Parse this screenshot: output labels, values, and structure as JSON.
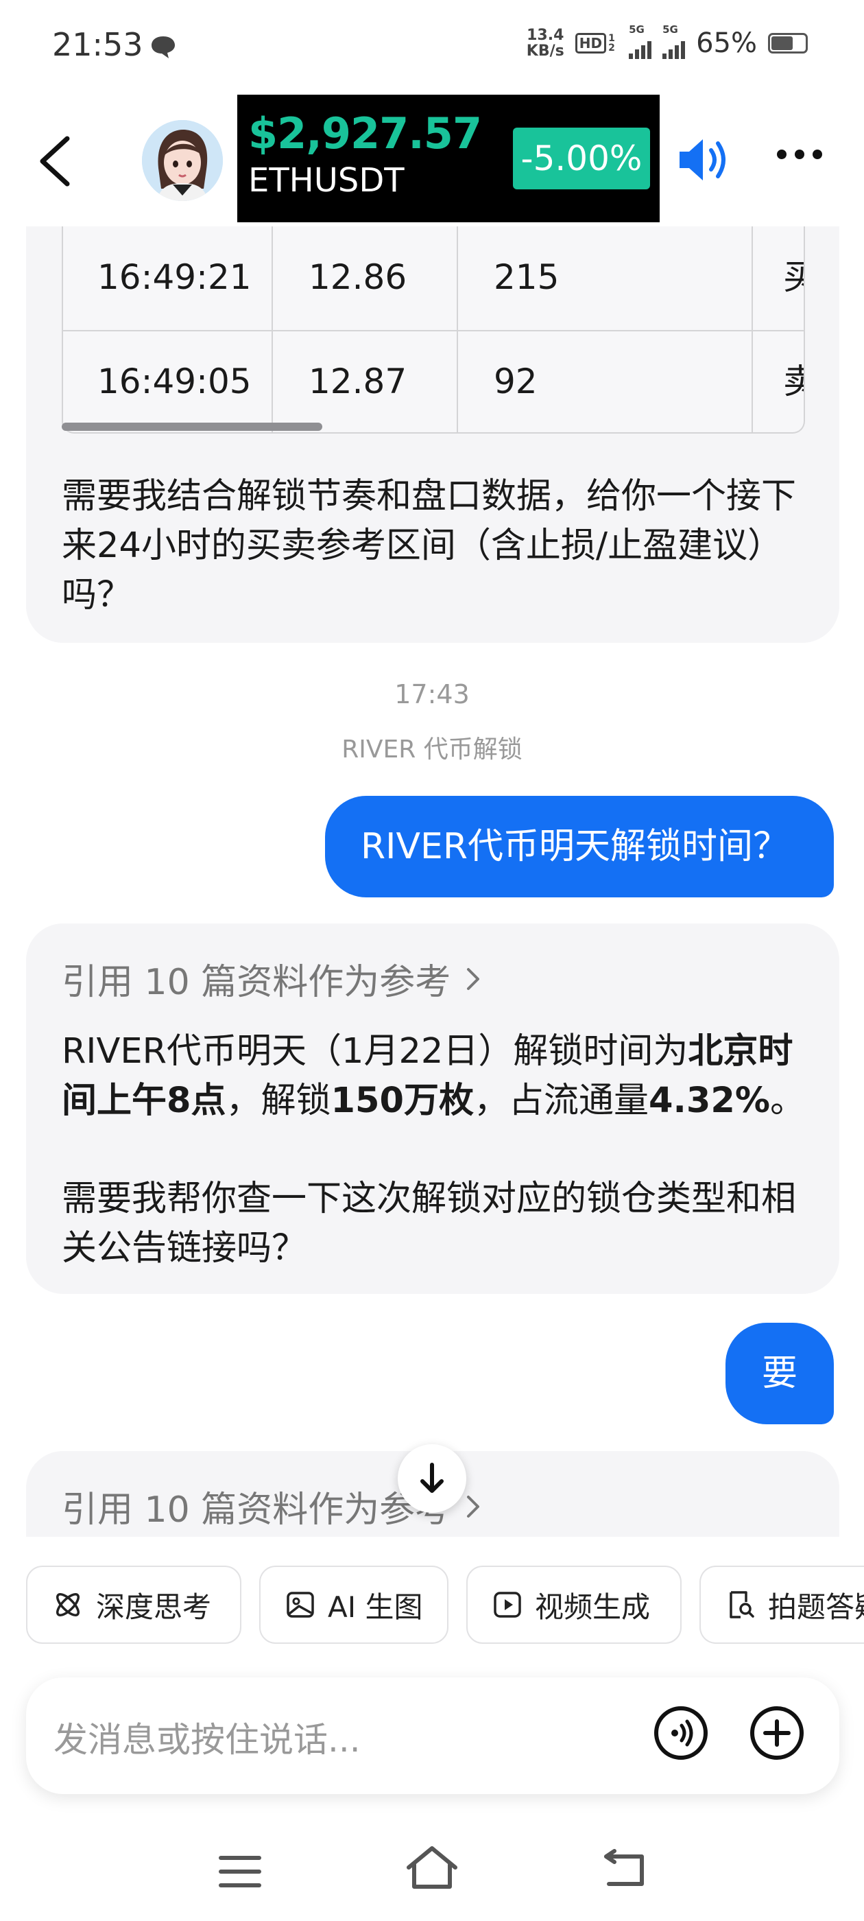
{
  "status_bar": {
    "time": "21:53",
    "net_speed_value": "13.4",
    "net_speed_unit": "KB/s",
    "hd_label": "HD",
    "hd_sub": "1 2",
    "signal1_label": "5G",
    "signal2_label": "5G",
    "battery": "65%"
  },
  "ticker": {
    "price": "$2,927.57",
    "pair": "ETHUSDT",
    "change": "-5.00%",
    "accent_color": "#19c39a"
  },
  "table": {
    "rows": [
      {
        "time": "16:49:21",
        "price": "12.86",
        "qty": "215",
        "side": "买"
      },
      {
        "time": "16:49:05",
        "price": "12.87",
        "qty": "92",
        "side": "卖"
      }
    ]
  },
  "messages": {
    "top_question": "需要我结合解锁节奏和盘口数据，给你一个接下来24小时的买卖参考区间（含止损/止盈建议）吗？",
    "timestamp": "17:43",
    "topic_label": "RIVER 代币解锁",
    "user_question_1": "RIVER代币明天解锁时间？",
    "ref_label": "引用 10 篇资料作为参考",
    "answer": {
      "part1": "RIVER代币明天（1月22日）解锁时间为",
      "bold1": "北京时间上午8点",
      "part2": "，解锁",
      "bold2": "150万枚",
      "part3": "，占流通量",
      "bold3": "4.32%",
      "part4": "。"
    },
    "answer_followup": "需要我帮你查一下这次解锁对应的锁仓类型和相关公告链接吗？",
    "user_reply_2": "要",
    "ref_label_2": "引用 10 篇资料作为参考"
  },
  "quick_actions": [
    {
      "label": "深度思考",
      "icon": "atom-icon"
    },
    {
      "label": "AI 生图",
      "icon": "image-icon"
    },
    {
      "label": "视频生成",
      "icon": "video-icon"
    },
    {
      "label": "拍题答疑",
      "icon": "search-doc-icon"
    }
  ],
  "input": {
    "placeholder": "发消息或按住说话..."
  },
  "colors": {
    "user_bubble": "#1470f4",
    "card_bg": "#f5f5f7"
  }
}
